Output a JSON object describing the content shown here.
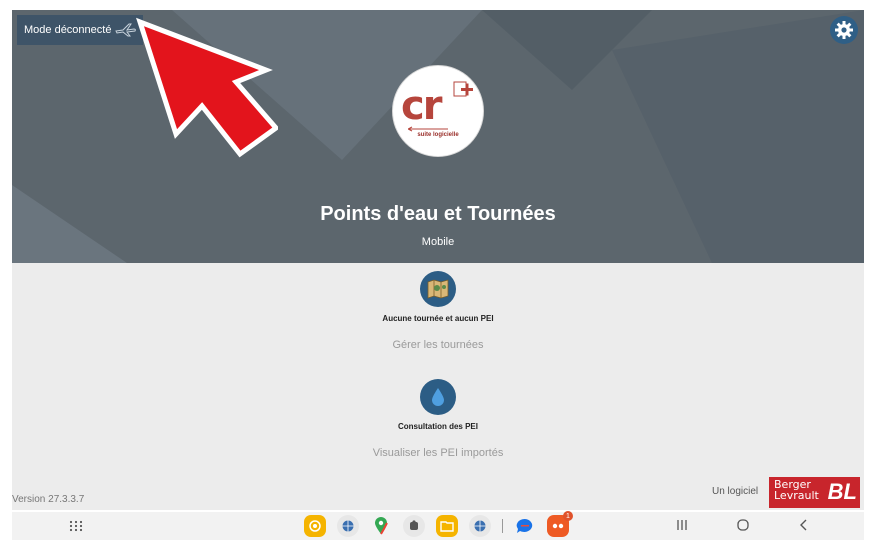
{
  "header": {
    "offline_label": "Mode déconnecté",
    "app_title": "Points d'eau et Tournées",
    "app_subtitle": "Mobile",
    "logo_text": "cr",
    "logo_subtitle": "suite logicielle"
  },
  "actions": [
    {
      "title": "Aucune tournée et aucun PEI",
      "link": "Gérer les tournées",
      "icon": "map-icon"
    },
    {
      "title": "Consultation des PEI",
      "link": "Visualiser les PEI importés",
      "icon": "water-drop-icon"
    }
  ],
  "footer": {
    "version": "Version 27.3.3.7",
    "publisher_prefix": "Un logiciel",
    "publisher_name_line1": "Berger",
    "publisher_name_line2": "Levrault",
    "publisher_mark": "BL"
  },
  "navbar": {
    "notification_count": "1",
    "dock_icons": [
      "target-app-icon",
      "globe-app-icon",
      "maps-app-icon",
      "puzzle-app-icon",
      "files-app-icon",
      "globe-app-icon",
      "messages-app-icon",
      "game-app-icon"
    ]
  },
  "colors": {
    "hero_bg": "#5c666d",
    "accent_blue": "#2c5d85",
    "badge_bg": "#3e5468",
    "arrow_red": "#e3141c",
    "brand_red": "#c8252c"
  }
}
